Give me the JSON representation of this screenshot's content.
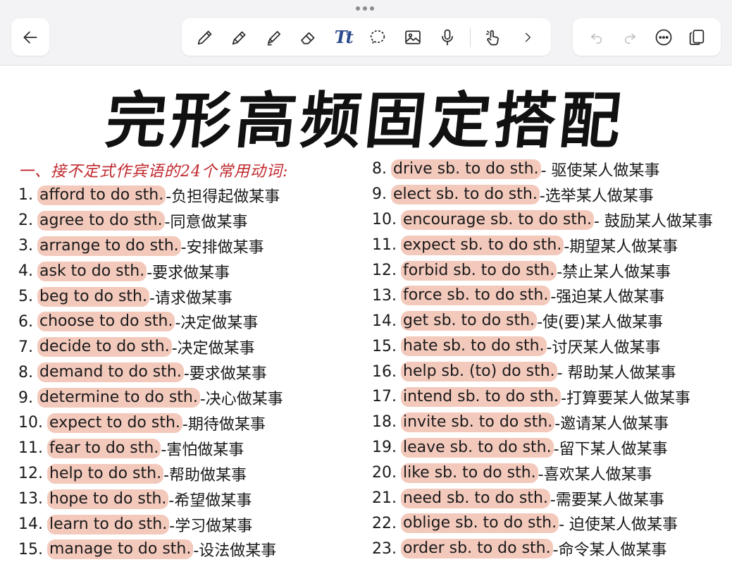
{
  "toolbar": {
    "back_icon": "arrow-left-icon",
    "tools": [
      "pencil-icon",
      "pen-icon",
      "highlighter-icon",
      "eraser-icon",
      "text-tool-icon",
      "lasso-icon",
      "image-icon",
      "microphone-icon",
      "hand-pointer-icon",
      "chevron-right-icon"
    ],
    "text_tool_label": "Tt",
    "right": [
      "undo-icon",
      "redo-icon",
      "more-icon",
      "pages-icon"
    ]
  },
  "note": {
    "title": "完形高频固定搭配",
    "heading": "一、接不定式作宾语的24个常用动词:",
    "left_items": [
      {
        "num": "1.",
        "phrase": "afford to do sth.",
        "meaning": "-负担得起做某事"
      },
      {
        "num": "2.",
        "phrase": "agree to do sth.",
        "meaning": "-同意做某事"
      },
      {
        "num": "3.",
        "phrase": "arrange to do sth.",
        "meaning": "-安排做某事"
      },
      {
        "num": "4.",
        "phrase": "ask to do sth.",
        "meaning": "-要求做某事"
      },
      {
        "num": "5.",
        "phrase": "beg to do sth.",
        "meaning": "-请求做某事"
      },
      {
        "num": "6.",
        "phrase": "choose to do sth.",
        "meaning": "-决定做某事"
      },
      {
        "num": "7.",
        "phrase": "decide to do sth.",
        "meaning": "-决定做某事"
      },
      {
        "num": "8.",
        "phrase": "demand to do sth.",
        "meaning": "-要求做某事"
      },
      {
        "num": "9.",
        "phrase": "determine to do sth.",
        "meaning": "-决心做某事"
      },
      {
        "num": "10.",
        "phrase": "expect to do sth.",
        "meaning": "-期待做某事"
      },
      {
        "num": "11.",
        "phrase": "fear to do sth.",
        "meaning": "-害怕做某事"
      },
      {
        "num": "12.",
        "phrase": "help to do sth.",
        "meaning": "-帮助做某事"
      },
      {
        "num": "13.",
        "phrase": "hope to do sth.",
        "meaning": "-希望做某事"
      },
      {
        "num": "14.",
        "phrase": "learn to do sth.",
        "meaning": " -学习做某事"
      },
      {
        "num": "15.",
        "phrase": "manage to do sth.",
        "meaning": "-设法做某事"
      }
    ],
    "right_items": [
      {
        "num": "8.",
        "phrase": "drive sb. to do sth.",
        "meaning": "- 驱使某人做某事"
      },
      {
        "num": "9.",
        "phrase": "elect sb. to do sth.",
        "meaning": "-选举某人做某事"
      },
      {
        "num": "10.",
        "phrase": "encourage sb. to do sth.",
        "meaning": "- 鼓励某人做某事"
      },
      {
        "num": "11.",
        "phrase": "expect sb. to do sth.",
        "meaning": " -期望某人做某事"
      },
      {
        "num": "12.",
        "phrase": "forbid sb. to do sth.",
        "meaning": "-禁止某人做某事"
      },
      {
        "num": "13.",
        "phrase": "force sb. to do sth.",
        "meaning": "-强迫某人做某事"
      },
      {
        "num": "14.",
        "phrase": "get sb. to do sth.",
        "meaning": "-使(要)某人做某事"
      },
      {
        "num": "15.",
        "phrase": "hate sb. to do sth.",
        "meaning": "-讨厌某人做某事"
      },
      {
        "num": "16.",
        "phrase": "help sb. (to) do sth.",
        "meaning": " - 帮助某人做某事"
      },
      {
        "num": "17.",
        "phrase": "intend sb. to do sth.",
        "meaning": " -打算要某人做某事"
      },
      {
        "num": "18.",
        "phrase": "invite sb. to do sth.",
        "meaning": "-邀请某人做某事"
      },
      {
        "num": "19.",
        "phrase": "leave sb. to do sth.",
        "meaning": "-留下某人做某事"
      },
      {
        "num": "20.",
        "phrase": "like sb. to do sth.",
        "meaning": "-喜欢某人做某事"
      },
      {
        "num": "21.",
        "phrase": "need sb. to do sth.",
        "meaning": "-需要某人做某事"
      },
      {
        "num": "22.",
        "phrase": "oblige sb. to do sth.",
        "meaning": "- 迫使某人做某事"
      },
      {
        "num": "23.",
        "phrase": "order sb. to do sth.",
        "meaning": " -命令某人做某事"
      }
    ]
  },
  "colors": {
    "highlight": "#f3c9bc",
    "heading": "#c0282d",
    "icon": "#2b2b2b",
    "text_tool": "#2b4a8c"
  }
}
